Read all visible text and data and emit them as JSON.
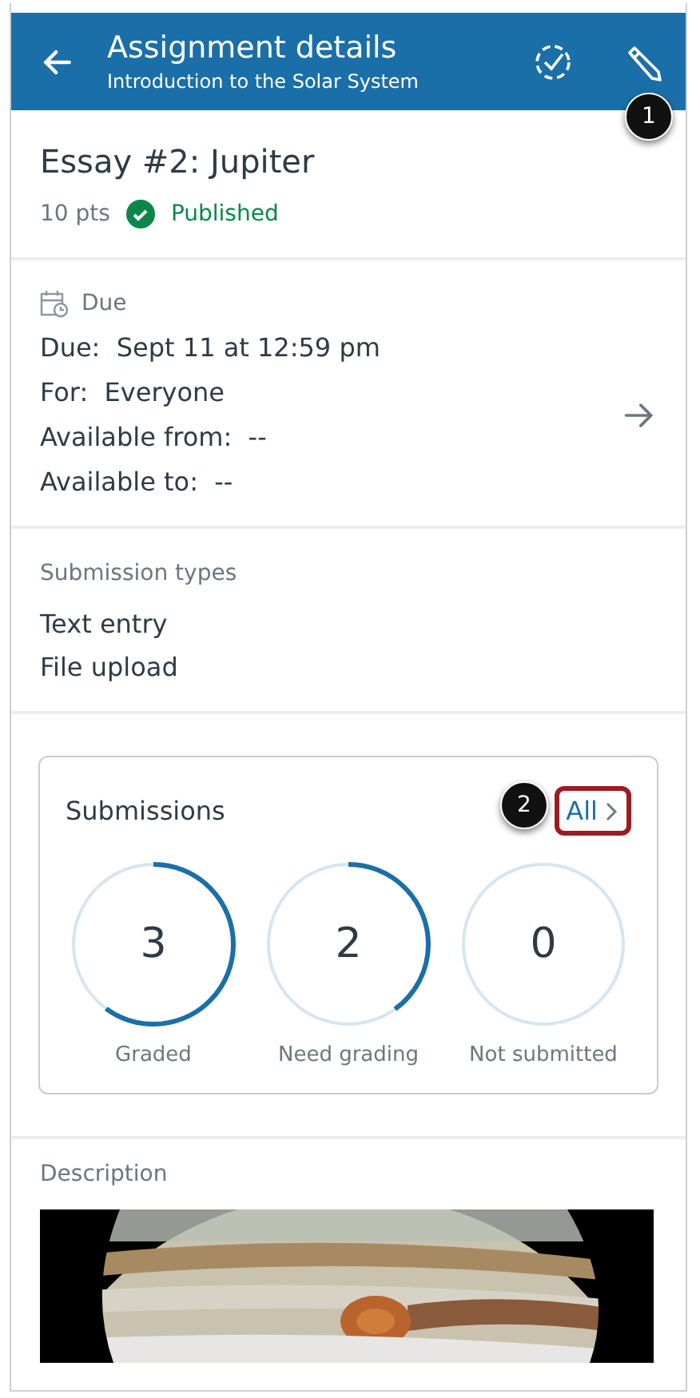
{
  "header": {
    "title": "Assignment details",
    "subtitle": "Introduction to the Solar System"
  },
  "callouts": [
    {
      "label": "1"
    },
    {
      "label": "2"
    }
  ],
  "assignment": {
    "title": "Essay #2: Jupiter",
    "points": "10 pts",
    "status": {
      "label": "Published",
      "published": true
    }
  },
  "due": {
    "heading": "Due",
    "lines": [
      "Due:  Sept 11 at 12:59 pm",
      "For:  Everyone",
      "Available from:  --",
      "Available to:  --"
    ]
  },
  "submission_types": {
    "heading": "Submission types",
    "items": [
      "Text entry",
      "File upload"
    ]
  },
  "submissions": {
    "title": "Submissions",
    "link": "All",
    "highlighted": true,
    "stats": [
      {
        "count": "3",
        "label": "Graded"
      },
      {
        "count": "2",
        "label": "Need grading"
      },
      {
        "count": "0",
        "label": "Not submitted"
      }
    ]
  },
  "description": {
    "heading": "Description"
  }
}
